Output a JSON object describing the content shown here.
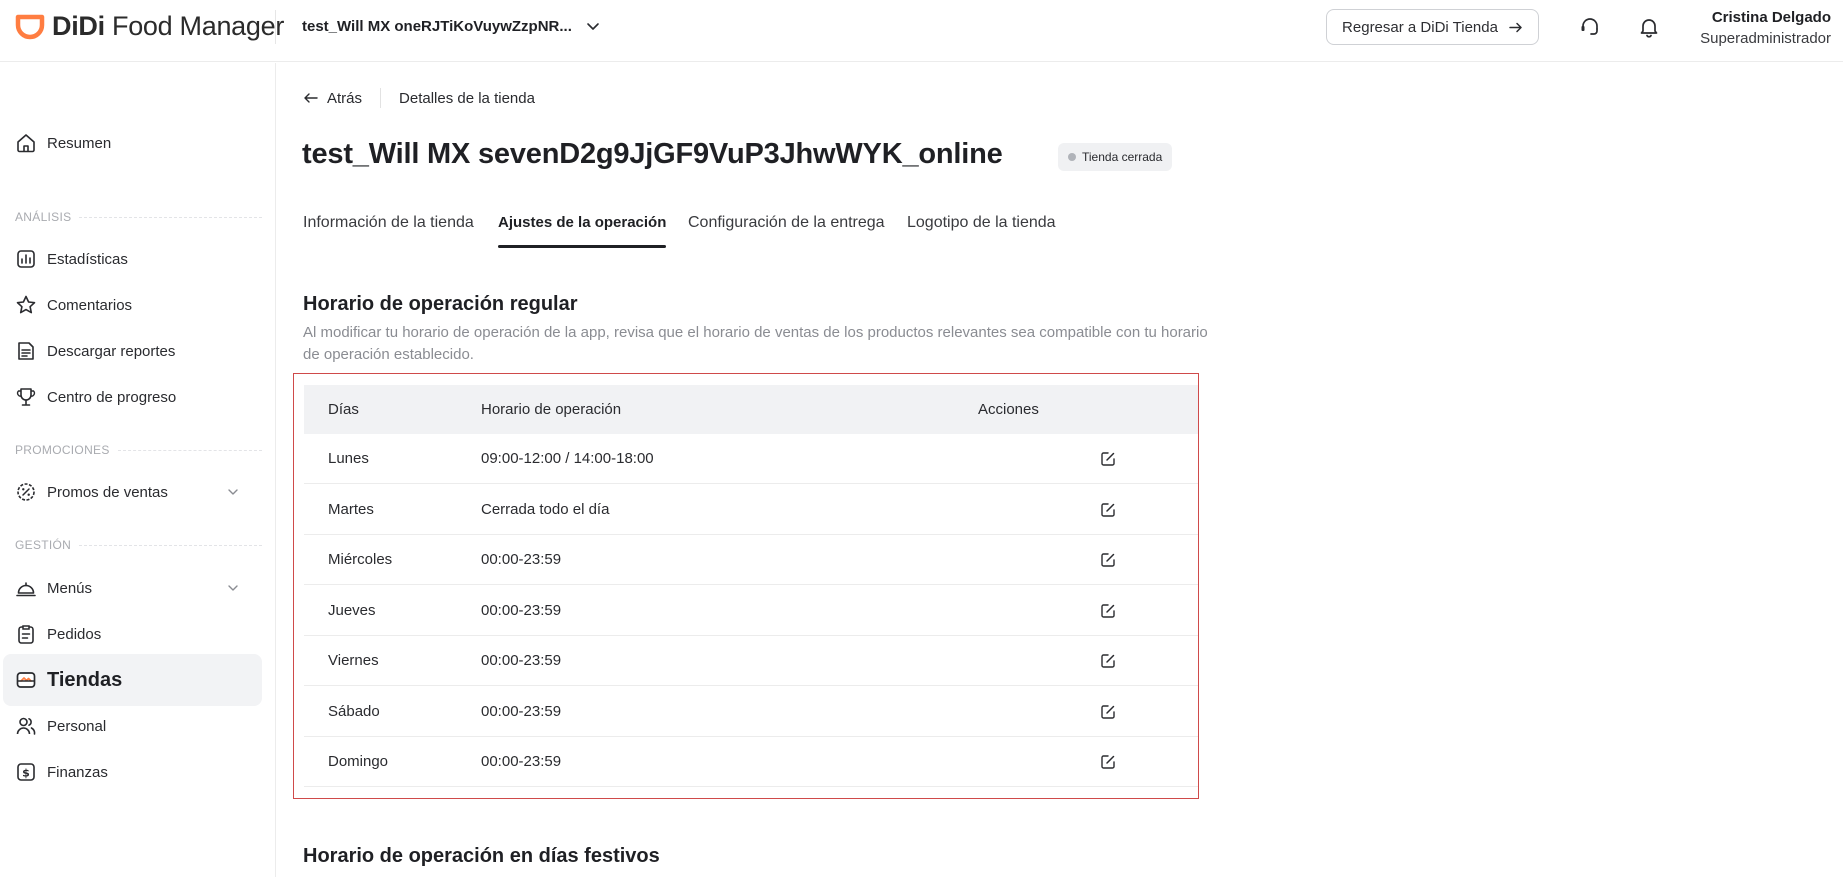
{
  "header": {
    "logo_text_bold": "DiDi",
    "logo_text_rest": " Food Manager",
    "store_selector": "test_Will MX oneRJTiKoVuywZzpNR...",
    "back_to_store_label": "Regresar a DiDi Tienda",
    "user_name": "Cristina Delgado",
    "user_role": "Superadministrador"
  },
  "sidebar": {
    "items": [
      {
        "label": "Resumen",
        "icon": "home-icon"
      },
      {
        "label": "Estadísticas",
        "icon": "chart-icon"
      },
      {
        "label": "Comentarios",
        "icon": "star-icon"
      },
      {
        "label": "Descargar reportes",
        "icon": "report-icon"
      },
      {
        "label": "Centro de progreso",
        "icon": "trophy-icon"
      },
      {
        "label": "Promos de ventas",
        "icon": "promo-icon"
      },
      {
        "label": "Menús",
        "icon": "cloche-icon"
      },
      {
        "label": "Pedidos",
        "icon": "clipboard-icon"
      },
      {
        "label": "Tiendas",
        "icon": "store-icon"
      },
      {
        "label": "Personal",
        "icon": "people-icon"
      },
      {
        "label": "Finanzas",
        "icon": "money-icon"
      }
    ],
    "sections": {
      "analisis": "ANÁLISIS",
      "promociones": "PROMOCIONES",
      "gestion": "GESTIÓN"
    }
  },
  "breadcrumb": {
    "back": "Atrás",
    "current": "Detalles de la tienda"
  },
  "page": {
    "title": "test_Will MX sevenD2g9JjGF9VuP3JhwWYK_online",
    "status": "Tienda cerrada"
  },
  "tabs": [
    {
      "label": "Información de la tienda"
    },
    {
      "label": "Ajustes de la operación",
      "active": true
    },
    {
      "label": "Configuración de la entrega"
    },
    {
      "label": "Logotipo de la tienda"
    }
  ],
  "regular": {
    "title": "Horario de operación regular",
    "description": "Al modificar tu horario de operación de la app, revisa que el horario de ventas de los productos relevantes sea compatible con tu horario de operación establecido.",
    "columns": [
      "Días",
      "Horario de operación",
      "Acciones"
    ],
    "rows": [
      {
        "day": "Lunes",
        "hours": "09:00-12:00 / 14:00-18:00"
      },
      {
        "day": "Martes",
        "hours": "Cerrada todo el día"
      },
      {
        "day": "Miércoles",
        "hours": "00:00-23:59"
      },
      {
        "day": "Jueves",
        "hours": "00:00-23:59"
      },
      {
        "day": "Viernes",
        "hours": "00:00-23:59"
      },
      {
        "day": "Sábado",
        "hours": "00:00-23:59"
      },
      {
        "day": "Domingo",
        "hours": "00:00-23:59"
      }
    ]
  },
  "holiday": {
    "title": "Horario de operación en días festivos"
  },
  "colors": {
    "brand_orange": "#ff7d41",
    "table_outline": "#cf4a4a"
  }
}
